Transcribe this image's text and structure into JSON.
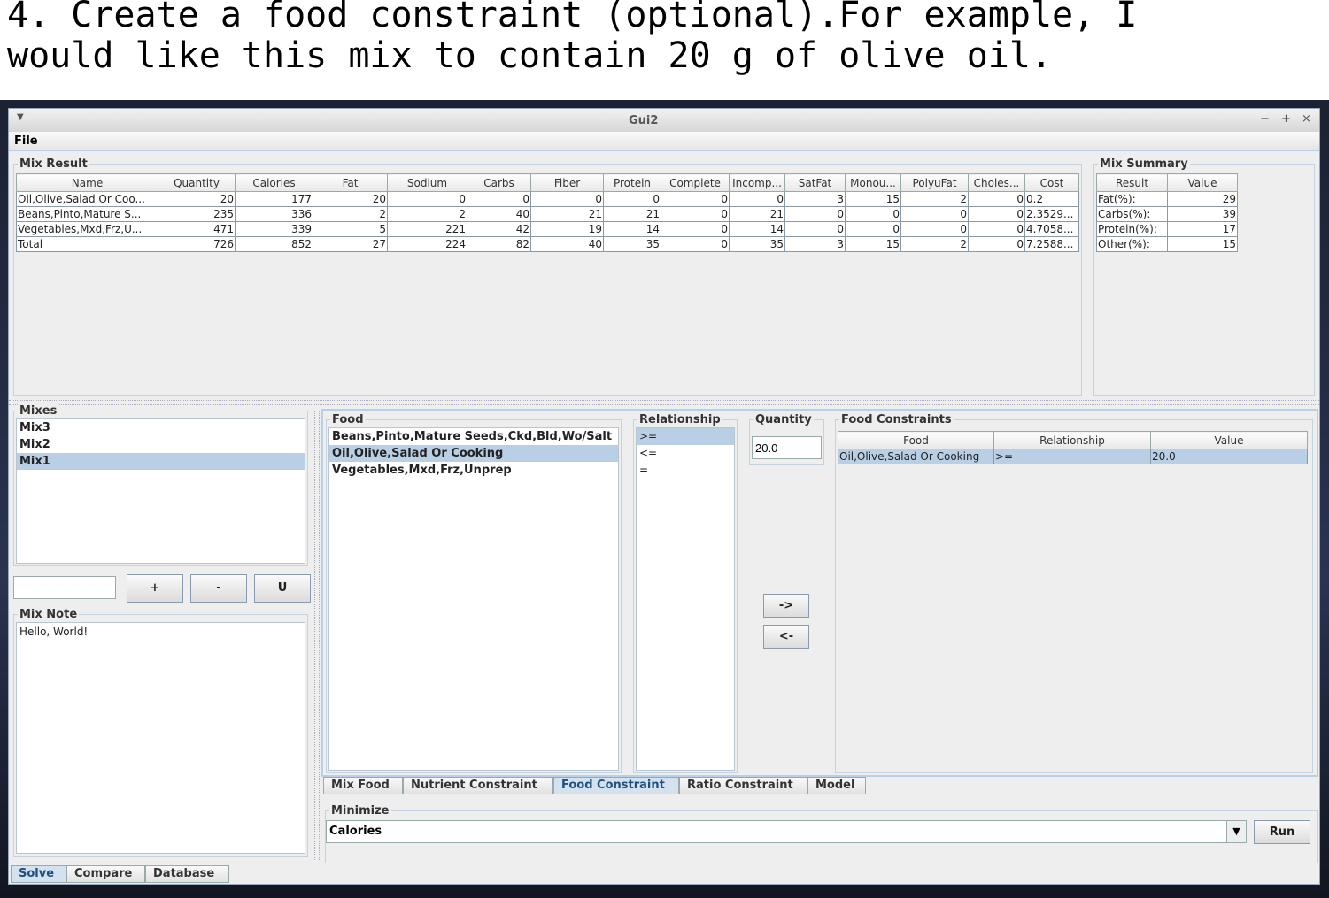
{
  "caption": "4. Create a food constraint (optional).For example, I\nwould like this mix to contain 20 g of olive oil.",
  "window": {
    "title": "Gui2",
    "menu": "File",
    "controls": [
      "−",
      "+",
      "×"
    ]
  },
  "mix_result": {
    "title": "Mix Result",
    "columns": [
      "Name",
      "Quantity",
      "Calories",
      "Fat",
      "Sodium",
      "Carbs",
      "Fiber",
      "Protein",
      "Complete",
      "Incomp...",
      "SatFat",
      "Monou...",
      "PolyuFat",
      "Choles...",
      "Cost"
    ],
    "rows": [
      [
        "Oil,Olive,Salad Or Coo...",
        "20",
        "177",
        "20",
        "0",
        "0",
        "0",
        "0",
        "0",
        "0",
        "3",
        "15",
        "2",
        "0",
        "0.2"
      ],
      [
        "Beans,Pinto,Mature S...",
        "235",
        "336",
        "2",
        "2",
        "40",
        "21",
        "21",
        "0",
        "21",
        "0",
        "0",
        "0",
        "0",
        "2.3529..."
      ],
      [
        "Vegetables,Mxd,Frz,U...",
        "471",
        "339",
        "5",
        "221",
        "42",
        "19",
        "14",
        "0",
        "14",
        "0",
        "0",
        "0",
        "0",
        "4.7058..."
      ],
      [
        "Total",
        "726",
        "852",
        "27",
        "224",
        "82",
        "40",
        "35",
        "0",
        "35",
        "3",
        "15",
        "2",
        "0",
        "7.2588..."
      ]
    ]
  },
  "mix_summary": {
    "title": "Mix Summary",
    "columns": [
      "Result",
      "Value"
    ],
    "rows": [
      [
        "Fat(%):",
        "29"
      ],
      [
        "Carbs(%):",
        "39"
      ],
      [
        "Protein(%):",
        "17"
      ],
      [
        "Other(%):",
        "15"
      ]
    ]
  },
  "mixes": {
    "title": "Mixes",
    "items": [
      "Mix3",
      "Mix2",
      "Mix1"
    ],
    "selected": 2,
    "input_value": "",
    "buttons": [
      "+",
      "-",
      "U"
    ]
  },
  "mix_note": {
    "title": "Mix Note",
    "text": "Hello, World!"
  },
  "food": {
    "title": "Food",
    "items": [
      "Beans,Pinto,Mature Seeds,Ckd,Bld,Wo/Salt",
      "Oil,Olive,Salad Or Cooking",
      "Vegetables,Mxd,Frz,Unprep"
    ],
    "selected": 1
  },
  "relationship": {
    "title": "Relationship",
    "items": [
      ">=",
      "<=",
      "="
    ],
    "selected": 0
  },
  "quantity": {
    "title": "Quantity",
    "value": "20.0"
  },
  "move_buttons": {
    "add": "->",
    "remove": "<-"
  },
  "food_constraints": {
    "title": "Food Constraints",
    "columns": [
      "Food",
      "Relationship",
      "Value"
    ],
    "rows": [
      [
        "Oil,Olive,Salad Or Cooking",
        ">=",
        "20.0"
      ]
    ]
  },
  "inner_tabs": [
    {
      "label": "Mix Food"
    },
    {
      "label": "Nutrient Constraint"
    },
    {
      "label": "Food Constraint",
      "active": true
    },
    {
      "label": "Ratio Constraint"
    },
    {
      "label": "Model"
    }
  ],
  "minimize": {
    "title": "Minimize",
    "value": "Calories",
    "run": "Run"
  },
  "bottom_tabs": [
    {
      "label": "Solve",
      "active": true
    },
    {
      "label": "Compare"
    },
    {
      "label": "Database"
    }
  ],
  "colors": {
    "selection": "#b8cfe5",
    "border": "#c5d3e0"
  }
}
